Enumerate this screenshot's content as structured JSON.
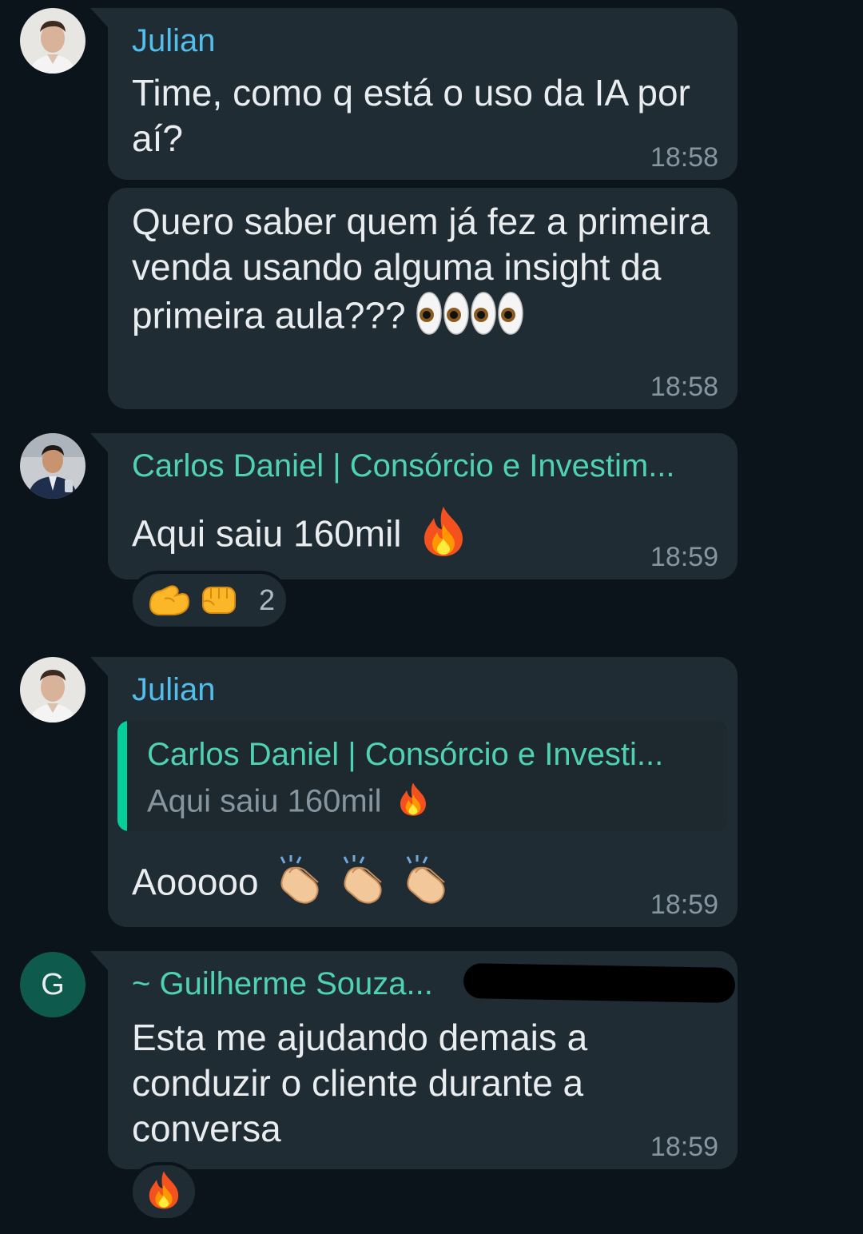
{
  "messages": [
    {
      "sender": "Julian",
      "text": "Time, como q está o uso da IA por aí?",
      "time": "18:58"
    },
    {
      "text": "Quero saber quem já fez a primeira venda usando alguma insight da primeira aula???",
      "emoji": [
        "eyes-icon",
        "eyes-icon"
      ],
      "time": "18:58"
    },
    {
      "sender": "Carlos Daniel | Consórcio e Investim...",
      "text": "Aqui saiu 160mil",
      "emoji": [
        "fire-icon"
      ],
      "time": "18:59",
      "reactions": {
        "icons": [
          "flexed-biceps-icon",
          "oncoming-fist-icon"
        ],
        "count": "2"
      }
    },
    {
      "sender": "Julian",
      "quote": {
        "name": "Carlos Daniel | Consórcio e Investi...",
        "text": "Aqui saiu 160mil"
      },
      "text": "Aooooo",
      "emoji": [
        "clapping-hands-icon",
        "clapping-hands-icon",
        "clapping-hands-icon"
      ],
      "time": "18:59"
    },
    {
      "avatar_letter": "G",
      "sender": "~ Guilherme Souza...",
      "text": "Esta me ajudando demais a conduzir o cliente durante a conversa",
      "time": "18:59",
      "reactions": {
        "icons": [
          "fire-icon"
        ]
      }
    }
  ],
  "colors": {
    "background": "#0b141a",
    "bubble": "#202c33",
    "sender_blue": "#53bdeb",
    "sender_teal": "#4fd1b4",
    "timestamp": "#8696a0",
    "avatar_green": "#0e5a4c"
  }
}
